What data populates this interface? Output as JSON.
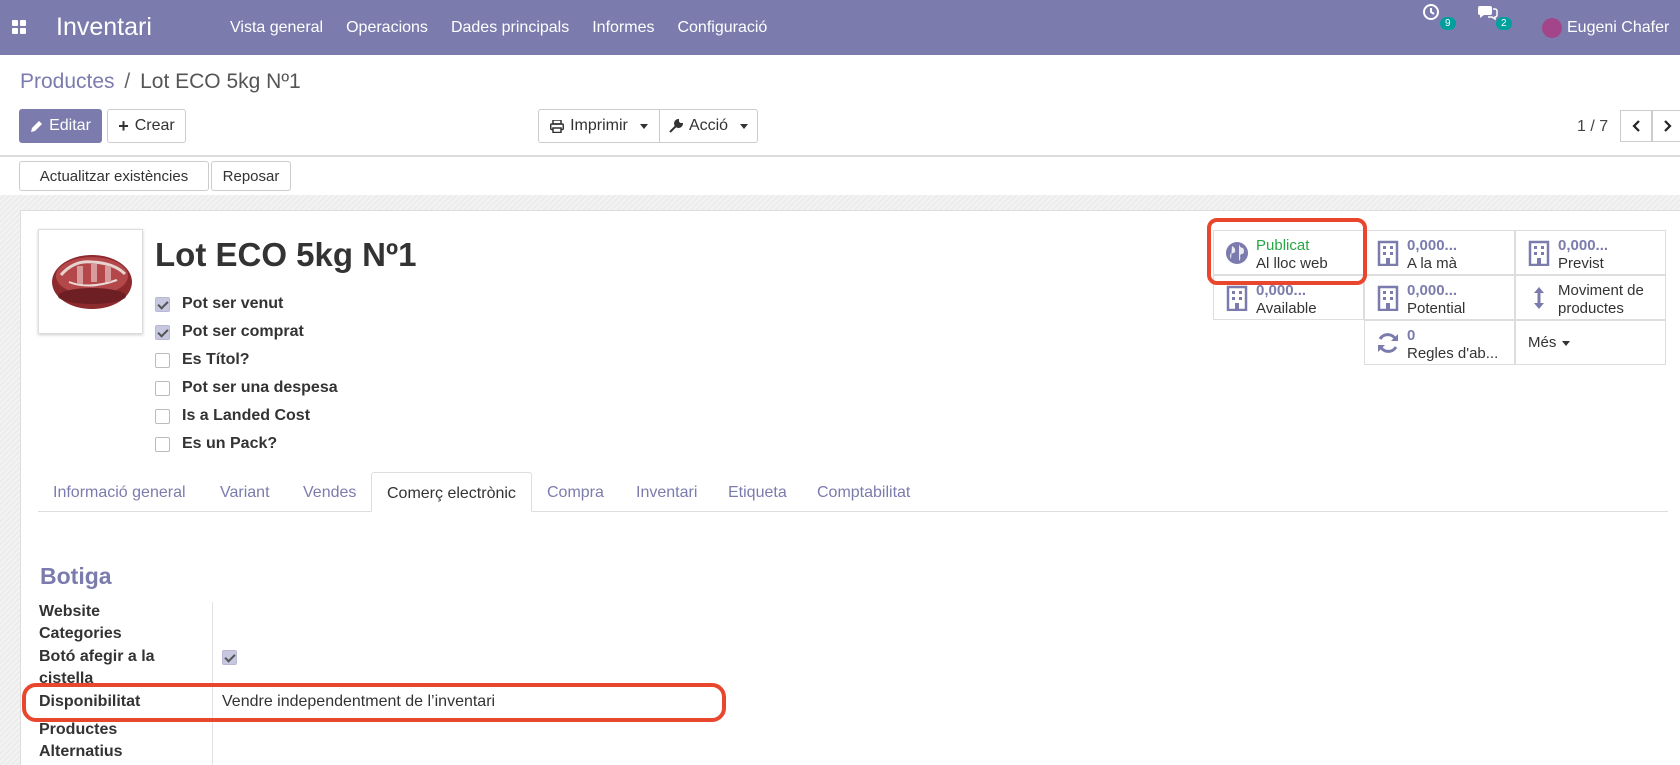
{
  "app": {
    "brand": "Inventari",
    "menu": [
      "Vista general",
      "Operacions",
      "Dades principals",
      "Informes",
      "Configuració"
    ],
    "activity_count": "9",
    "messages_count": "2",
    "user_name": "Eugeni Chafer"
  },
  "breadcrumb": {
    "parent": "Productes",
    "separator": "/",
    "current": "Lot ECO 5kg Nº1"
  },
  "toolbar": {
    "edit": "Editar",
    "create": "Crear",
    "print": "Imprimir",
    "action": "Acció",
    "pager": "1 / 7"
  },
  "status_buttons": {
    "update_stock": "Actualitzar existències",
    "replenish": "Reposar"
  },
  "product": {
    "name": "Lot ECO 5kg Nº1",
    "checkboxes": [
      {
        "label": "Pot ser venut",
        "checked": true
      },
      {
        "label": "Pot ser comprat",
        "checked": true
      },
      {
        "label": "Es Títol?",
        "checked": false
      },
      {
        "label": "Pot ser una despesa",
        "checked": false
      },
      {
        "label": "Is a Landed Cost",
        "checked": false
      },
      {
        "label": "Es un Pack?",
        "checked": false
      }
    ]
  },
  "smart_buttons": {
    "published": {
      "line1": "Publicat",
      "line2": "Al lloc web"
    },
    "on_hand": {
      "line1": "0,000...",
      "line2": "A la mà"
    },
    "forecast": {
      "line1": "0,000...",
      "line2": "Previst"
    },
    "available": {
      "line1": "0,000...",
      "line2": "Available"
    },
    "potential": {
      "line1": "0,000...",
      "line2": "Potential"
    },
    "moves": {
      "line1": "Moviment de",
      "line2": "productes"
    },
    "reorder": {
      "line1": "0",
      "line2": "Regles d'ab..."
    },
    "more": "Més"
  },
  "tabs": [
    "Informació general",
    "Variant",
    "Vendes",
    "Comerç electrònic",
    "Compra",
    "Inventari",
    "Etiqueta",
    "Comptabilitat"
  ],
  "active_tab": "Comerç electrònic",
  "shop": {
    "title": "Botiga",
    "website_categories_label_1": "Website",
    "website_categories_label_2": "Categories",
    "add_to_cart_label_1": "Botó afegir a la",
    "add_to_cart_label_2": "cistella",
    "add_to_cart_checked": true,
    "availability_label": "Disponibilitat",
    "availability_value": "Vendre independentment de l’inventari",
    "alternative_label_1": "Productes",
    "alternative_label_2": "Alternatius"
  },
  "colors": {
    "brand": "#7c7bad",
    "highlight": "#e8472d",
    "published": "#28a745"
  }
}
